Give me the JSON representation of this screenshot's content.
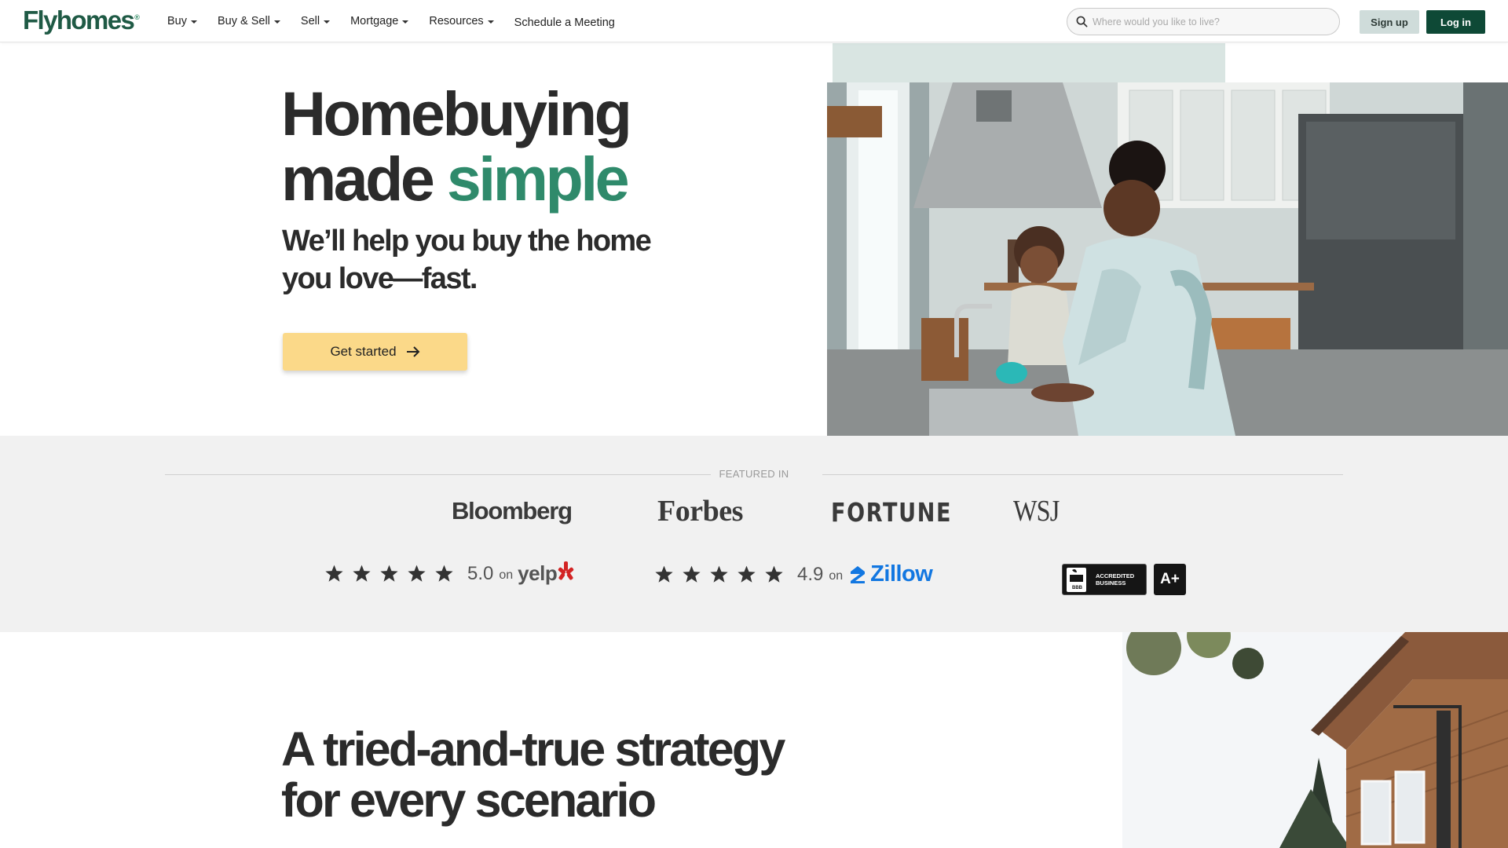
{
  "nav": {
    "logo": "Flyhomes",
    "logo_mark": "®",
    "menu": [
      {
        "label": "Buy"
      },
      {
        "label": "Buy & Sell"
      },
      {
        "label": "Sell"
      },
      {
        "label": "Mortgage"
      },
      {
        "label": "Resources"
      }
    ],
    "schedule_label": "Schedule a Meeting",
    "search_placeholder": "Where would you like to live?",
    "signup_label": "Sign up",
    "login_label": "Log in",
    "icons": {
      "search": "search-icon",
      "caret": "chevron-down-icon"
    }
  },
  "hero": {
    "title_line1": "Homebuying",
    "title_line2_prefix": "made ",
    "title_line2_accent": "simple",
    "subtitle": "We’ll help you buy the home you love—fast.",
    "cta_label": "Get started",
    "cta_icon": "arrow-right-icon",
    "accent_color": "#2f8a6b",
    "cta_color": "#fbd989"
  },
  "featured": {
    "label": "FEATURED IN",
    "press": [
      "Bloomberg",
      "Forbes",
      "FORTUNE",
      "WSJ"
    ],
    "ratings": [
      {
        "stars": 5,
        "value": "5.0",
        "on": "on",
        "source": "yelp"
      },
      {
        "stars": 5,
        "value": "4.9",
        "on": "on",
        "source": "Zillow"
      }
    ],
    "bbb": {
      "line1": "ACCREDITED",
      "line2": "BUSINESS",
      "mark": "BBB",
      "grade": "A+"
    }
  },
  "strategy": {
    "title_line1": "A tried-and-true strategy",
    "title_line2": "for every scenario"
  },
  "colors": {
    "brand_dark": "#0e4936",
    "brand_green": "#2f8a6b",
    "signup_bg": "#cfdcda",
    "featured_bg": "#f1f1f1",
    "zillow_blue": "#1277e1",
    "yelp_red": "#d32323"
  }
}
